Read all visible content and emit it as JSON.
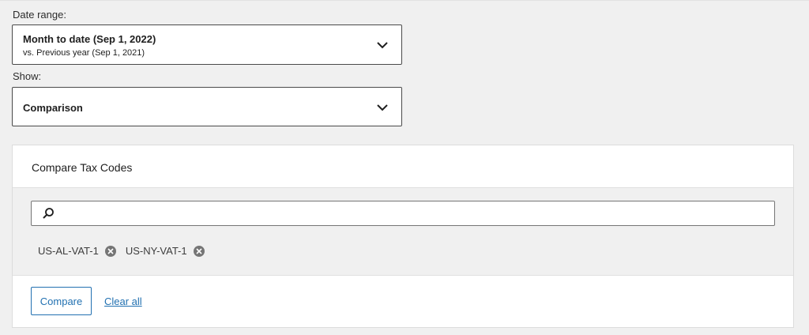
{
  "date_range": {
    "label": "Date range:",
    "primary": "Month to date (Sep 1, 2022)",
    "secondary": "vs. Previous year (Sep 1, 2021)"
  },
  "show": {
    "label": "Show:",
    "value": "Comparison"
  },
  "compare_card": {
    "title": "Compare Tax Codes",
    "search_value": "",
    "tags": [
      "US-AL-VAT-1",
      "US-NY-VAT-1"
    ],
    "compare_label": "Compare",
    "clear_label": "Clear all"
  },
  "colors": {
    "accent": "#2271b1",
    "background": "#f0f0f0"
  },
  "icons": [
    "chevron-down-icon",
    "search-icon",
    "remove-tag-icon"
  ]
}
